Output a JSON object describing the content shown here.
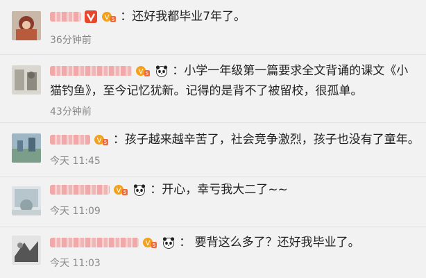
{
  "comments": [
    {
      "text": "：还好我都毕业7年了。",
      "time": "36分钟前",
      "badges": [
        "verified-v-icon",
        "vip-level-icon"
      ]
    },
    {
      "text": "：小学一年级第一篇要求全文背诵的课文《小猫钓鱼》，至今记忆犹新。记得的是背不了被留校，很孤单。",
      "time": "43分钟前",
      "badges": [
        "vip-level-icon",
        "panda-icon"
      ]
    },
    {
      "text": "：孩子越来越辛苦了，社会竞争激烈，孩子也没有了童年。",
      "time": "今天 11:45",
      "badges": [
        "vip-level-icon"
      ]
    },
    {
      "text": "：开心，幸亏我大二了~~",
      "time": "今天 11:09",
      "badges": [
        "vip-level-icon",
        "panda-icon"
      ]
    },
    {
      "text": "： 要背这么多了？还好我毕业了。",
      "time": "今天 11:03",
      "badges": [
        "vip-level-icon",
        "panda-icon"
      ]
    }
  ],
  "colors": {
    "background": "#f2f2f2",
    "blurred_name": "#ef8f8f",
    "vip_badge": "#f4a11d",
    "verified_badge": "#e8472e",
    "time_text": "#888888"
  }
}
